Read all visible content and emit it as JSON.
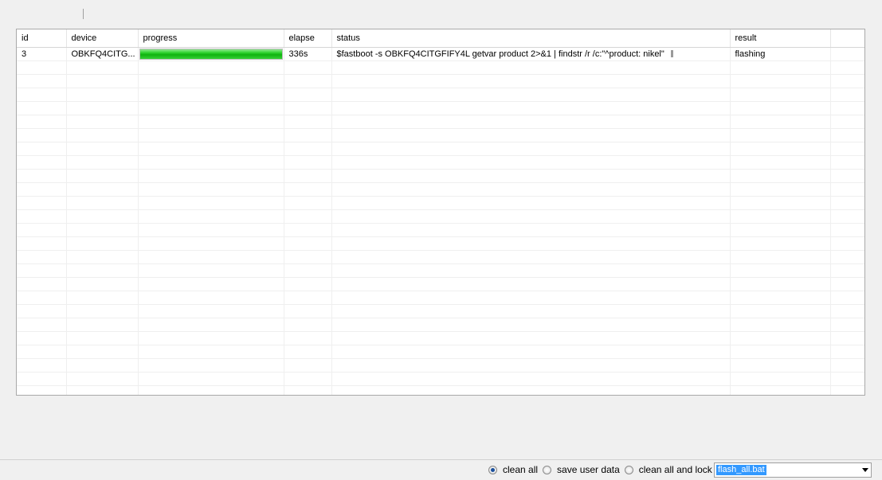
{
  "grid": {
    "columns": [
      "id",
      "device",
      "progress",
      "elapse",
      "status",
      "result"
    ],
    "rows": [
      {
        "id": "3",
        "device": "OBKFQ4CITG...",
        "progress": 100,
        "elapse": "336s",
        "status": "$fastboot -s OBKFQ4CITGFIFY4L getvar product   2>&1  | findstr /r /c:\"^product: nikel\"",
        "result": "flashing"
      }
    ]
  },
  "bottom": {
    "options": [
      {
        "label": "clean all",
        "checked": true
      },
      {
        "label": "save user data",
        "checked": false
      },
      {
        "label": "clean all and lock",
        "checked": false
      }
    ],
    "script_select": "flash_all.bat"
  },
  "colors": {
    "progress_green": "#0fb20f",
    "selection_blue": "#3399ff"
  }
}
